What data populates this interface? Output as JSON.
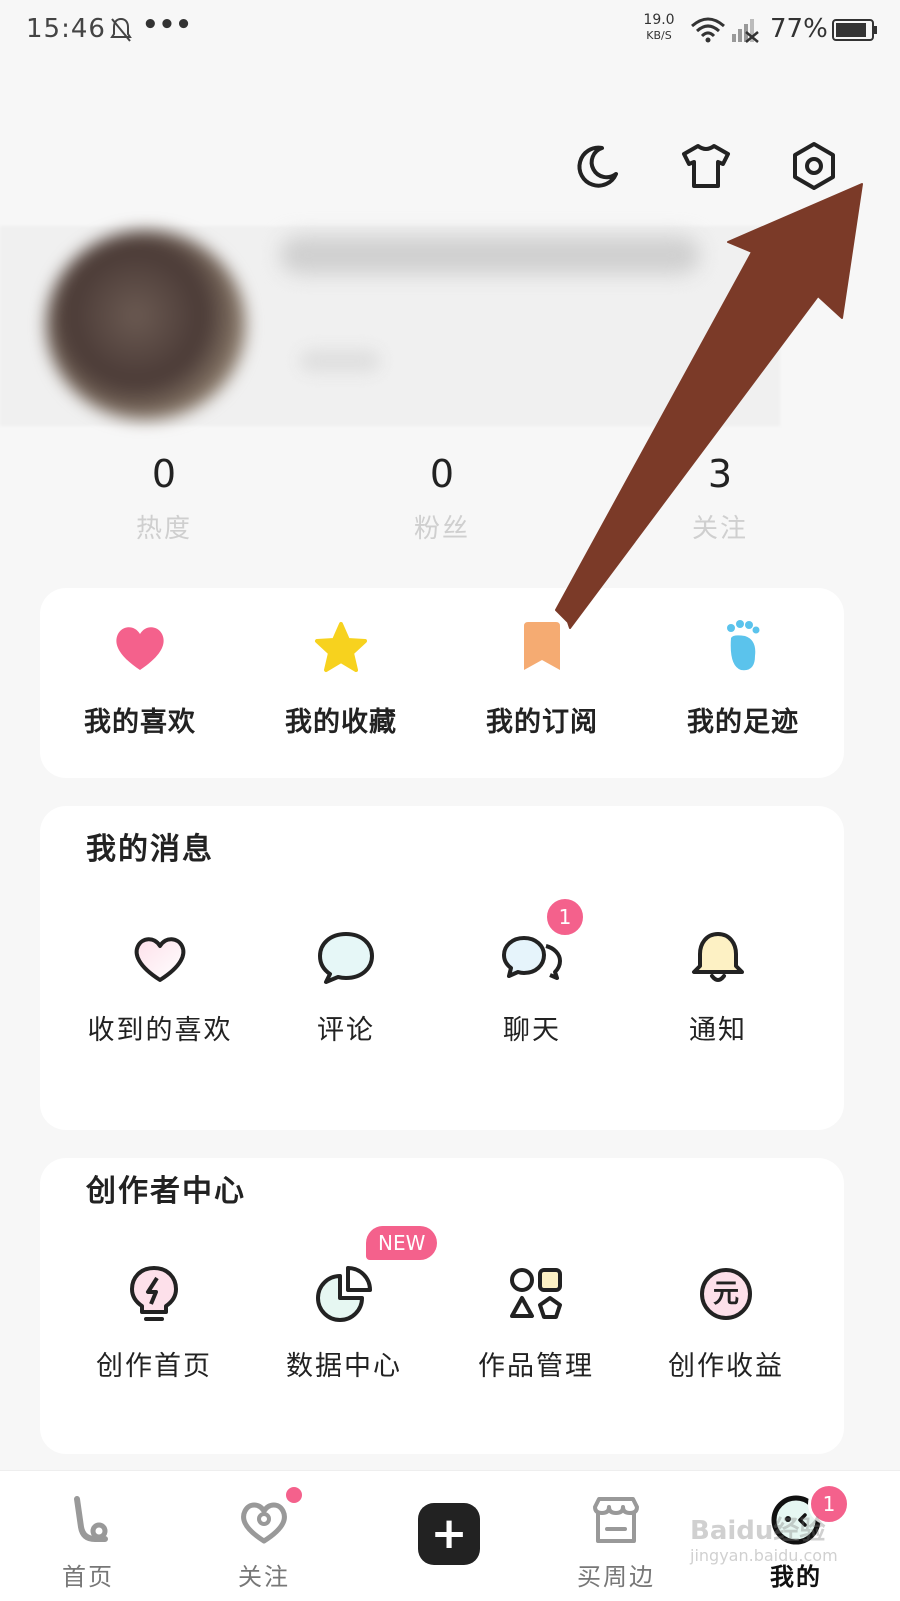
{
  "status_bar": {
    "time": "15:46",
    "more": "•••",
    "net_speed_value": "19.0",
    "net_speed_unit": "KB/S",
    "battery": "77%"
  },
  "top_icons": [
    "moon-icon",
    "tshirt-icon",
    "settings-icon"
  ],
  "stats": [
    {
      "value": "0",
      "label": "热度"
    },
    {
      "value": "0",
      "label": "粉丝"
    },
    {
      "value": "3",
      "label": "关注"
    }
  ],
  "quick_links": [
    {
      "label": "我的喜欢",
      "icon": "heart-icon",
      "color": "#f4618c"
    },
    {
      "label": "我的收藏",
      "icon": "star-icon",
      "color": "#f7d21e"
    },
    {
      "label": "我的订阅",
      "icon": "bookmark-icon",
      "color": "#f5ab72"
    },
    {
      "label": "我的足迹",
      "icon": "footprint-icon",
      "color": "#5bc3ec"
    }
  ],
  "messages": {
    "title": "我的消息",
    "items": [
      {
        "label": "收到的喜欢",
        "icon": "heart-outline-icon"
      },
      {
        "label": "评论",
        "icon": "comment-icon"
      },
      {
        "label": "聊天",
        "icon": "chat-icon",
        "badge": "1"
      },
      {
        "label": "通知",
        "icon": "bell-icon"
      }
    ]
  },
  "creator": {
    "title": "创作者中心",
    "items": [
      {
        "label": "创作首页",
        "icon": "lightbulb-icon"
      },
      {
        "label": "数据中心",
        "icon": "pie-chart-icon",
        "badge": "NEW"
      },
      {
        "label": "作品管理",
        "icon": "shapes-icon"
      },
      {
        "label": "创作收益",
        "icon": "yuan-coin-icon",
        "symbol": "元"
      }
    ]
  },
  "bottom_nav": {
    "items": [
      {
        "label": "首页",
        "icon": "home-icon"
      },
      {
        "label": "关注",
        "icon": "follow-icon"
      },
      {
        "label": "",
        "icon": "plus-icon"
      },
      {
        "label": "买周边",
        "icon": "shop-icon"
      },
      {
        "label": "我的",
        "icon": "profile-face-icon",
        "badge": "1"
      }
    ],
    "plus_symbol": "+"
  },
  "colors": {
    "accent_pink": "#f4618c",
    "annotation_arrow": "#7b3a28"
  },
  "watermark": {
    "line1": "Baidu经验",
    "line2": "jingyan.baidu.com"
  }
}
